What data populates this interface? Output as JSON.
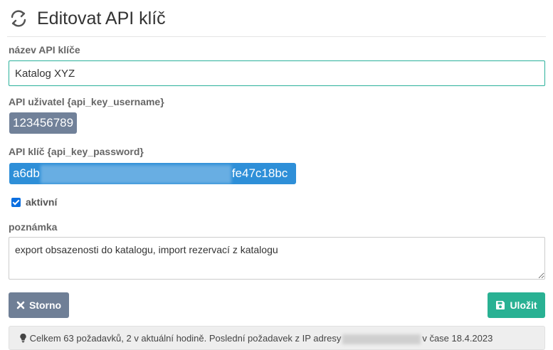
{
  "header": {
    "title": "Editovat API klíč",
    "icon": "refresh-icon"
  },
  "fields": {
    "name": {
      "label": "název API klíče",
      "value": "Katalog XYZ"
    },
    "username": {
      "label": "API uživatel {api_key_username}",
      "value": "123456789"
    },
    "password": {
      "label": "API klíč {api_key_password}",
      "prefix": "a6db",
      "suffix": "fe47c18bc"
    },
    "active": {
      "label": "aktivní",
      "checked": true
    },
    "note": {
      "label": "poznámka",
      "value": "export obsazenosti do katalogu, import rezervací z katalogu"
    }
  },
  "buttons": {
    "cancel": "Storno",
    "save": "Uložit"
  },
  "info": {
    "before_ip": "Celkem 63 požadavků, 2 v aktuální hodině. Poslední požadavek z IP adresy",
    "after_ip": "v čase 18.4.2023"
  },
  "colors": {
    "accent": "#2bb19b",
    "cancel": "#6f7f96",
    "save": "#29b193",
    "password_badge": "#2e8fd8",
    "username_badge": "#718199"
  }
}
